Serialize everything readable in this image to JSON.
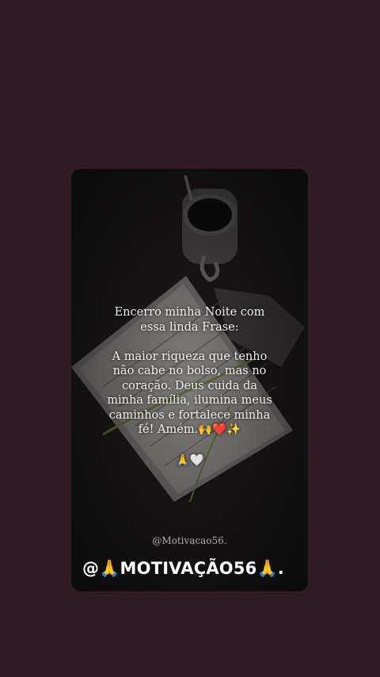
{
  "post": {
    "intro_line1": "Encerro minha Noite com",
    "intro_line2": "essa linda Frase:",
    "body_line1": "A maior riqueza que tenho",
    "body_line2": "não cabe no bolso, mas no",
    "body_line3": "coração. Deus cuida da",
    "body_line4": "minha família, ilumina meus",
    "body_line5": "caminhos e fortalece minha",
    "body_line6": "fé! Amém.🙌❤️✨",
    "emoji_line": "🙏🤍",
    "watermark": "@Motivacao56.",
    "handle": "@🙏MOTIVAÇÃO56🙏."
  },
  "colors": {
    "background": "#2e1d24",
    "card": "#1a1719",
    "text": "#f2f0ee"
  }
}
